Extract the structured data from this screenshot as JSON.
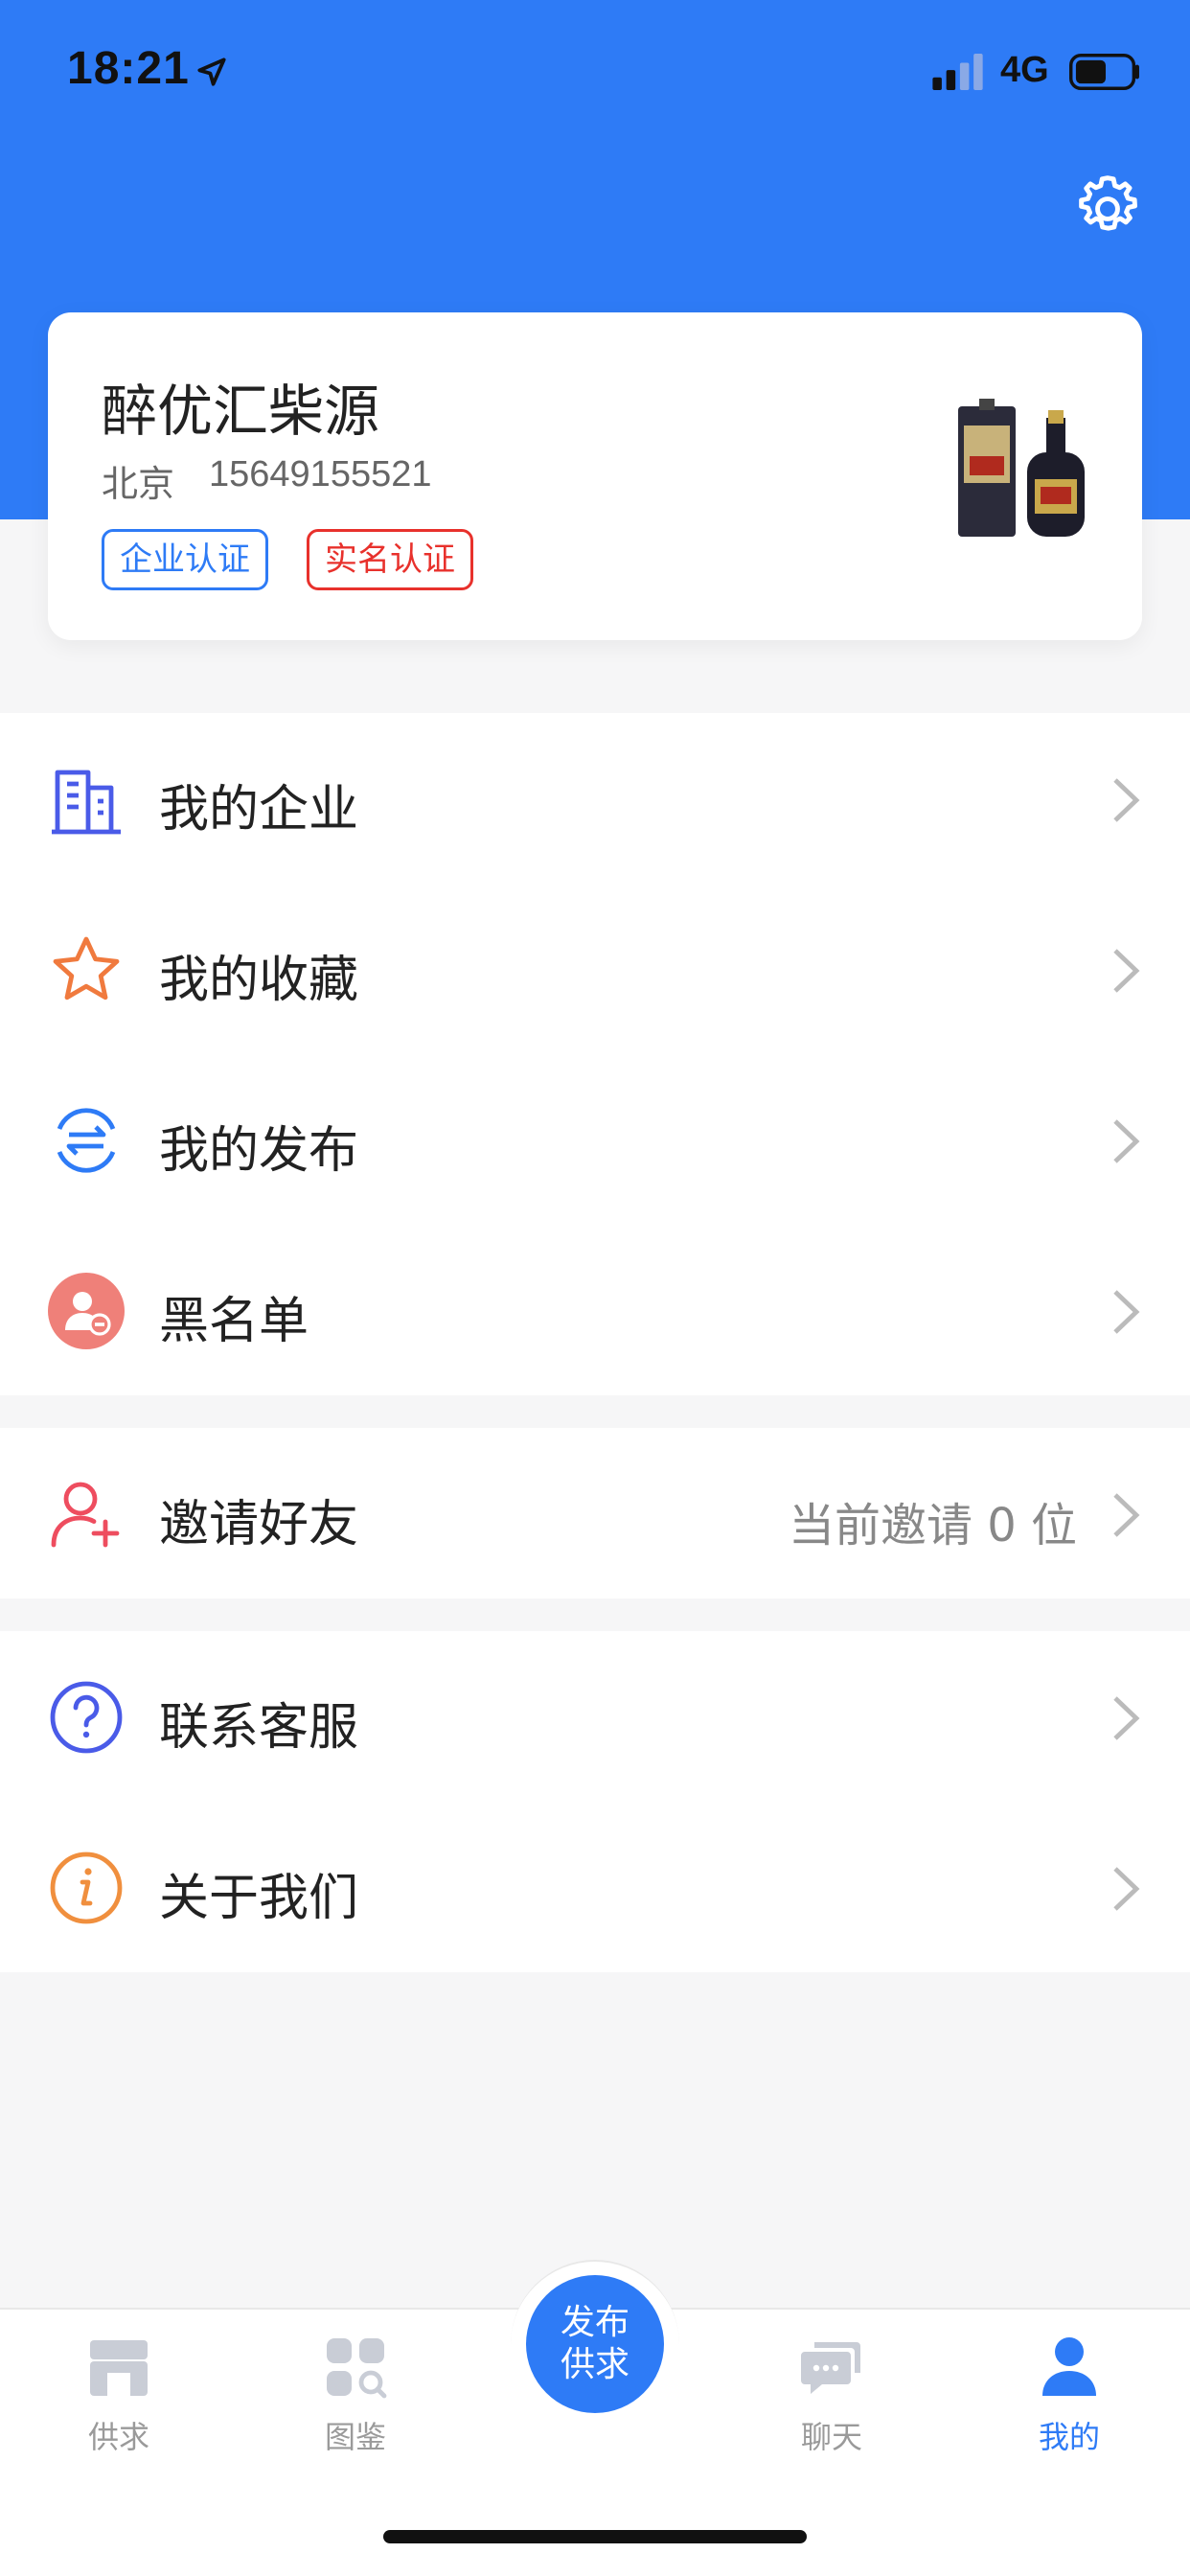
{
  "status_bar": {
    "time": "18:21",
    "network": "4G"
  },
  "profile": {
    "name": "醉优汇柴源",
    "city": "北京",
    "phone": "15649155521",
    "badges": [
      "企业认证",
      "实名认证"
    ]
  },
  "menu": {
    "group1": [
      {
        "label": "我的企业",
        "icon": "building-icon"
      },
      {
        "label": "我的收藏",
        "icon": "star-icon"
      },
      {
        "label": "我的发布",
        "icon": "publish-exchange-icon"
      },
      {
        "label": "黑名单",
        "icon": "blacklist-user-icon"
      }
    ],
    "group2": [
      {
        "label": "邀请好友",
        "icon": "add-friend-icon",
        "value": "当前邀请 0 位"
      }
    ],
    "group3": [
      {
        "label": "联系客服",
        "icon": "help-icon"
      },
      {
        "label": "关于我们",
        "icon": "info-icon"
      }
    ]
  },
  "tabbar": {
    "tabs": [
      {
        "label": "供求",
        "icon": "store-icon"
      },
      {
        "label": "图鉴",
        "icon": "catalog-icon"
      },
      {
        "label": "聊天",
        "icon": "chat-icon"
      },
      {
        "label": "我的",
        "icon": "user-icon",
        "active": true
      }
    ],
    "publish_line1": "发布",
    "publish_line2": "供求"
  },
  "colors": {
    "primary": "#2e7bf6",
    "danger": "#e8312c",
    "background": "#f6f6f7"
  }
}
